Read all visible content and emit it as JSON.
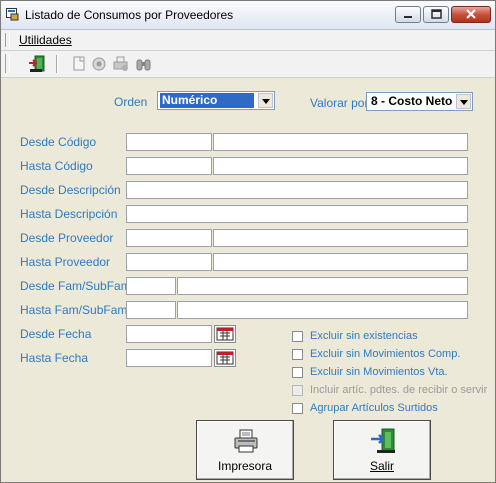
{
  "window": {
    "title": "Listado de Consumos por Proveedores"
  },
  "menu": {
    "items": [
      {
        "label": "Utilidades"
      }
    ]
  },
  "toolbar": {
    "icons": [
      "exit-door-icon",
      "new-doc-icon",
      "preview-icon",
      "print-setup-icon",
      "binoculars-icon"
    ]
  },
  "orden": {
    "label": "Orden",
    "value": "Numérico"
  },
  "valorar": {
    "label": "Valorar por",
    "value": "8 - Costo Neto"
  },
  "fields": {
    "desde_codigo": "Desde Código",
    "hasta_codigo": "Hasta Código",
    "desde_descripcion": "Desde Descripción",
    "hasta_descripcion": "Hasta Descripción",
    "desde_proveedor": "Desde Proveedor",
    "hasta_proveedor": "Hasta Proveedor",
    "desde_fam": "Desde Fam/SubFam",
    "hasta_fam": "Hasta Fam/SubFam",
    "desde_fecha": "Desde Fecha",
    "hasta_fecha": "Hasta Fecha"
  },
  "checks": [
    {
      "label": "Excluir sin existencias",
      "checked": false,
      "enabled": true
    },
    {
      "label": "Excluir sin Movimientos Comp.",
      "checked": false,
      "enabled": true
    },
    {
      "label": "Excluir sin Movimientos Vta.",
      "checked": false,
      "enabled": true
    },
    {
      "label": "Incluir artíc. pdtes. de recibir o servir",
      "checked": false,
      "enabled": false
    },
    {
      "label": "Agrupar Artículos Surtidos",
      "checked": false,
      "enabled": true
    }
  ],
  "buttons": {
    "print": "Impresora",
    "exit": "Salir"
  }
}
